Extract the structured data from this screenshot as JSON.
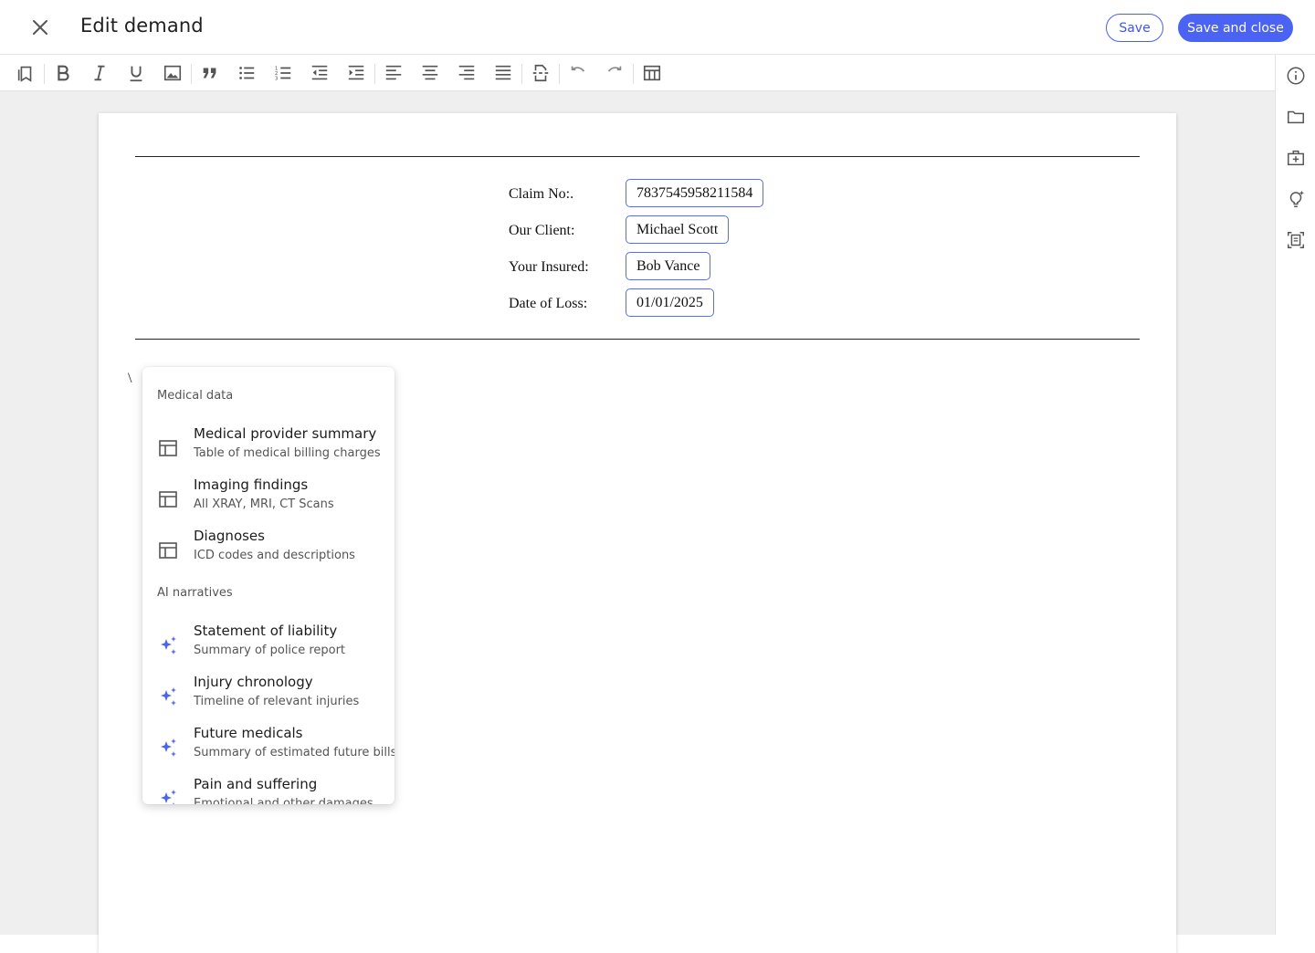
{
  "header": {
    "title": "Edit demand",
    "save_label": "Save",
    "save_close_label": "Save and close"
  },
  "toolbar": {
    "buttons": [
      "bookmark-icon",
      "bold-icon",
      "italic-icon",
      "underline-icon",
      "image-icon",
      "quote-icon",
      "bullet-list-icon",
      "numbered-list-icon",
      "outdent-icon",
      "indent-icon",
      "align-left-icon",
      "align-center-icon",
      "align-right-icon",
      "align-justify-icon",
      "page-break-icon",
      "undo-icon",
      "redo-icon",
      "table-icon"
    ]
  },
  "rail": {
    "buttons": [
      "info-icon",
      "folder-icon",
      "medical-kit-icon",
      "lightbulb-sparkle-icon",
      "document-scan-icon"
    ]
  },
  "document": {
    "fields": [
      {
        "label": "Claim No:.",
        "value": "7837545958211584"
      },
      {
        "label": "Our Client:",
        "value": "Michael Scott"
      },
      {
        "label": "Your Insured:",
        "value": "Bob Vance"
      },
      {
        "label": "Date of Loss:",
        "value": "01/01/2025"
      }
    ],
    "cursor_text": "\\"
  },
  "menu": {
    "sections": [
      {
        "title": "Medical data",
        "items": [
          {
            "title": "Medical provider summary",
            "subtitle": "Table of medical billing charges",
            "icon": "table-icon"
          },
          {
            "title": "Imaging findings",
            "subtitle": "All XRAY, MRI, CT Scans",
            "icon": "table-icon"
          },
          {
            "title": "Diagnoses",
            "subtitle": "ICD codes and descriptions",
            "icon": "table-icon"
          }
        ]
      },
      {
        "title": "AI narratives",
        "items": [
          {
            "title": "Statement of liability",
            "subtitle": "Summary of police report",
            "icon": "sparkle-icon"
          },
          {
            "title": "Injury chronology",
            "subtitle": "Timeline of relevant injuries",
            "icon": "sparkle-icon"
          },
          {
            "title": "Future medicals",
            "subtitle": "Summary of estimated future bills",
            "icon": "sparkle-icon"
          },
          {
            "title": "Pain and suffering",
            "subtitle": "Emotional and other damages",
            "icon": "sparkle-icon"
          }
        ]
      }
    ]
  },
  "colors": {
    "accent": "#4b63f2",
    "sparkle": "#4b63f2",
    "canvas": "#efefef"
  }
}
